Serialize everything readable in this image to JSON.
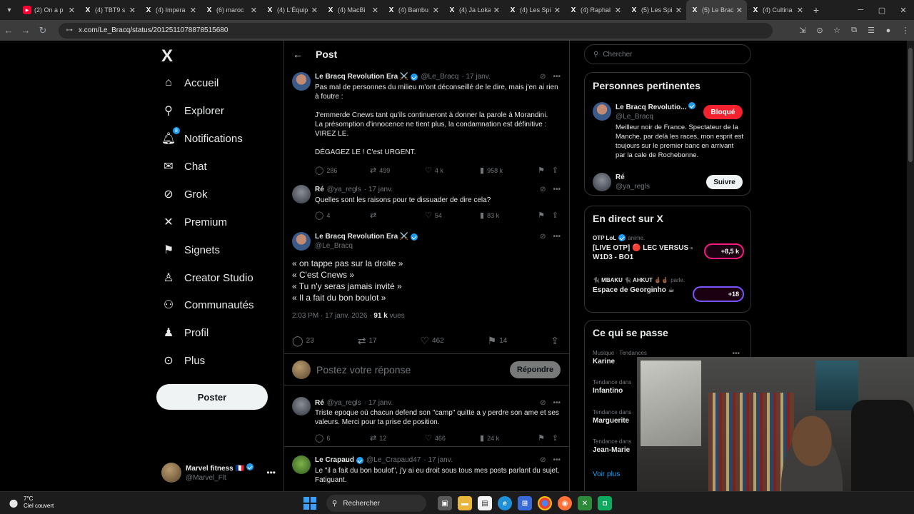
{
  "browser": {
    "tabs": [
      {
        "label": "(2) On a p",
        "icon": "youtube-icon"
      },
      {
        "label": "(4) TBT9 s",
        "icon": "x-icon"
      },
      {
        "label": "(4) Impera",
        "icon": "x-icon"
      },
      {
        "label": "(6) maroc",
        "icon": "x-icon"
      },
      {
        "label": "(4) L'Équip",
        "icon": "x-icon"
      },
      {
        "label": "(4) MacBi",
        "icon": "x-icon"
      },
      {
        "label": "(4) Bambu",
        "icon": "x-icon"
      },
      {
        "label": "(4) Ja Loka",
        "icon": "x-icon"
      },
      {
        "label": "(4) Les Spi",
        "icon": "x-icon"
      },
      {
        "label": "(4) Raphal",
        "icon": "x-icon"
      },
      {
        "label": "(5) Les Spi",
        "icon": "x-icon"
      },
      {
        "label": "(5) Le Brac",
        "icon": "x-icon",
        "active": true
      },
      {
        "label": "(4) Cultina",
        "icon": "x-icon"
      }
    ],
    "url": "x.com/Le_Bracq/status/2012511078878515680"
  },
  "nav": {
    "logo": "X",
    "items": [
      {
        "label": "Accueil",
        "icon": "home-icon"
      },
      {
        "label": "Explorer",
        "icon": "search-icon"
      },
      {
        "label": "Notifications",
        "icon": "bell-icon",
        "badge": "8"
      },
      {
        "label": "Chat",
        "icon": "mail-icon"
      },
      {
        "label": "Grok",
        "icon": "grok-icon"
      },
      {
        "label": "Premium",
        "icon": "x-icon"
      },
      {
        "label": "Signets",
        "icon": "bookmark-icon"
      },
      {
        "label": "Creator Studio",
        "icon": "creator-icon"
      },
      {
        "label": "Communautés",
        "icon": "communities-icon"
      },
      {
        "label": "Profil",
        "icon": "person-icon"
      },
      {
        "label": "Plus",
        "icon": "more-circle-icon"
      }
    ],
    "post_button": "Poster",
    "me": {
      "name": "Marvel fitness 🇫🇷",
      "handle": "@Marvel_Flt"
    }
  },
  "main": {
    "header_title": "Post",
    "tweets": [
      {
        "name": "Le Bracq Revolution Era ⚔️",
        "handle": "@Le_Bracq",
        "date": "· 17 janv.",
        "text": "Pas mal de personnes du milieu m'ont déconseillé de le dire, mais j'en ai rien à foutre :\n\nJ'emmerde Cnews tant qu'ils continueront à donner la parole à Morandini.\nLa présomption d'innocence ne tient plus, la condamnation est définitive : VIREZ LE.\n\nDÉGAGEZ LE ! C'est URGENT.",
        "replies": "286",
        "reposts": "499",
        "likes": "4 k",
        "views": "958 k"
      },
      {
        "name": "Ré",
        "handle": "@ya_regls",
        "date": "· 17 janv.",
        "text": "Quelles sont les raisons pour te dissuader de dire cela?",
        "replies": "4",
        "reposts": "",
        "likes": "54",
        "views": "83 k"
      }
    ],
    "focus": {
      "name": "Le Bracq Revolution Era ⚔️",
      "handle": "@Le_Bracq",
      "lines": [
        "« on tappe pas sur la droite »",
        "« C'est Cnews »",
        "« Tu n'y seras jamais invité »",
        "« Il a fait du bon boulot »"
      ],
      "time": "2:03 PM · 17 janv. 2026 ·",
      "views_count": "91 k",
      "views_label": "vues",
      "replies": "23",
      "reposts": "17",
      "likes": "462",
      "bookmarks": "14"
    },
    "reply_placeholder": "Postez votre réponse",
    "reply_button": "Répondre",
    "replies": [
      {
        "name": "Ré",
        "handle": "@ya_regls",
        "date": "· 17 janv.",
        "text": "Triste epoque où chacun defend son \"camp\" quitte a y perdre son ame et ses valeurs. Merci pour ta prise de position.",
        "replies": "6",
        "reposts": "12",
        "likes": "466",
        "views": "24 k"
      },
      {
        "name": "Le Crapaud",
        "handle": "@Le_Crapaud47",
        "date": "· 17 janv.",
        "text": "Le \"il a fait du bon boulot\", j'y ai eu droit sous tous mes posts parlant du sujet. Fatiguant."
      }
    ]
  },
  "right": {
    "search_placeholder": "Chercher",
    "relevant": {
      "title": "Personnes pertinentes",
      "p1": {
        "name": "Le Bracq Revolutio...",
        "handle": "@Le_Bracq",
        "button": "Bloqué",
        "bio": "Meilleur noir de France. Spectateur de la Manche, par delà les races, mon esprit est toujours sur le premier banc en arrivant par la cale de Rochebonne."
      },
      "p2": {
        "name": "Ré",
        "handle": "@ya_regls",
        "button": "Suivre"
      }
    },
    "live": {
      "title": "En direct sur X",
      "l1": {
        "host": "OTP LoL",
        "status": "anime.",
        "title": "[LIVE OTP] 🔴 LEC VERSUS - W1D3 - BO1",
        "count": "+8,5 k"
      },
      "l2": {
        "host": "🐈‍⬛ MBAKU 🐈‍⬛ AHKUT 🤞🏾🤞🏾",
        "status": "parle.",
        "title": "Espace de Georginho ☕",
        "count": "+18"
      }
    },
    "trends": {
      "title": "Ce qui se passe",
      "items": [
        {
          "context": "Musique · Tendances",
          "name": "Karine"
        },
        {
          "context": "Tendance dans",
          "name": "Infantino"
        },
        {
          "context": "Tendance dans",
          "name": "Marguerite"
        },
        {
          "context": "Tendance dans",
          "name": "Jean-Marie"
        }
      ],
      "more": "Voir plus"
    }
  },
  "taskbar": {
    "temp": "7°C",
    "weather": "Ciel couvert",
    "search": "Rechercher"
  }
}
